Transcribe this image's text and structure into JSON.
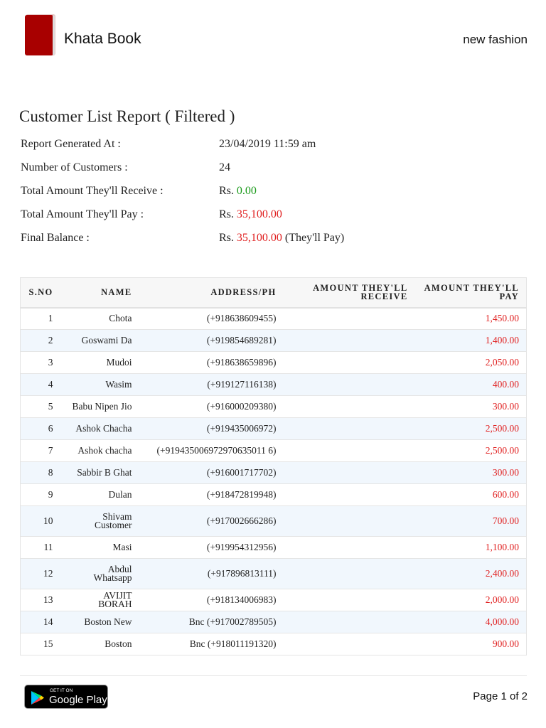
{
  "header": {
    "brand": "Khata Book",
    "shop": "new fashion"
  },
  "report": {
    "title": "Customer List Report ( Filtered )",
    "generated_label": "Report Generated At :",
    "generated_value": "23/04/2019 11:59 am",
    "customers_label": "Number of Customers :",
    "customers_value": "24",
    "receive_label": "Total Amount They'll Receive :",
    "receive_prefix": "Rs.",
    "receive_value": "0.00",
    "pay_label": "Total Amount They'll Pay :",
    "pay_prefix": "Rs.",
    "pay_value": "35,100.00",
    "balance_label": "Final Balance :",
    "balance_prefix": "Rs.",
    "balance_value": "35,100.00",
    "balance_suffix": "(They'll Pay)"
  },
  "table": {
    "headers": [
      "S.NO",
      "NAME",
      "ADDRESS/PH",
      "AMOUNT THEY'LL RECEIVE",
      "AMOUNT THEY'LL PAY"
    ],
    "rows": [
      [
        "1",
        "Chota",
        "(+918638609455)",
        "",
        "1,450.00"
      ],
      [
        "2",
        "Goswami Da",
        "(+919854689281)",
        "",
        "1,400.00"
      ],
      [
        "3",
        "Mudoi",
        "(+918638659896)",
        "",
        "2,050.00"
      ],
      [
        "4",
        "Wasim",
        "(+919127116138)",
        "",
        "400.00"
      ],
      [
        "5",
        "Babu Nipen Jio",
        "(+916000209380)",
        "",
        "300.00"
      ],
      [
        "6",
        "Ashok Chacha",
        "(+919435006972)",
        "",
        "2,500.00"
      ],
      [
        "7",
        "Ashok chacha",
        "(+919435006972970635011 6)",
        "",
        "2,500.00"
      ],
      [
        "8",
        "Sabbir B Ghat",
        "(+916001717702)",
        "",
        "300.00"
      ],
      [
        "9",
        "Dulan",
        "(+918472819948)",
        "",
        "600.00"
      ],
      [
        "10",
        "Shivam Customer",
        "(+917002666286)",
        "",
        "700.00"
      ],
      [
        "11",
        "Masi",
        "(+919954312956)",
        "",
        "1,100.00"
      ],
      [
        "12",
        "Abdul Whatsapp",
        "(+917896813111)",
        "",
        "2,400.00"
      ],
      [
        "13",
        "AVIJIT BORAH",
        "(+918134006983)",
        "",
        "2,000.00"
      ],
      [
        "14",
        "Boston New",
        "Bnc  (+917002789505)",
        "",
        "4,000.00"
      ],
      [
        "15",
        "Boston",
        "Bnc  (+918011191320)",
        "",
        "900.00"
      ]
    ]
  },
  "footer": {
    "badge_small": "GET IT ON",
    "badge_big": "Google Play",
    "page": "Page 1 of 2"
  },
  "colors": {
    "red": "#e02020",
    "green": "#1a9a1a",
    "logo": "#a80000"
  }
}
